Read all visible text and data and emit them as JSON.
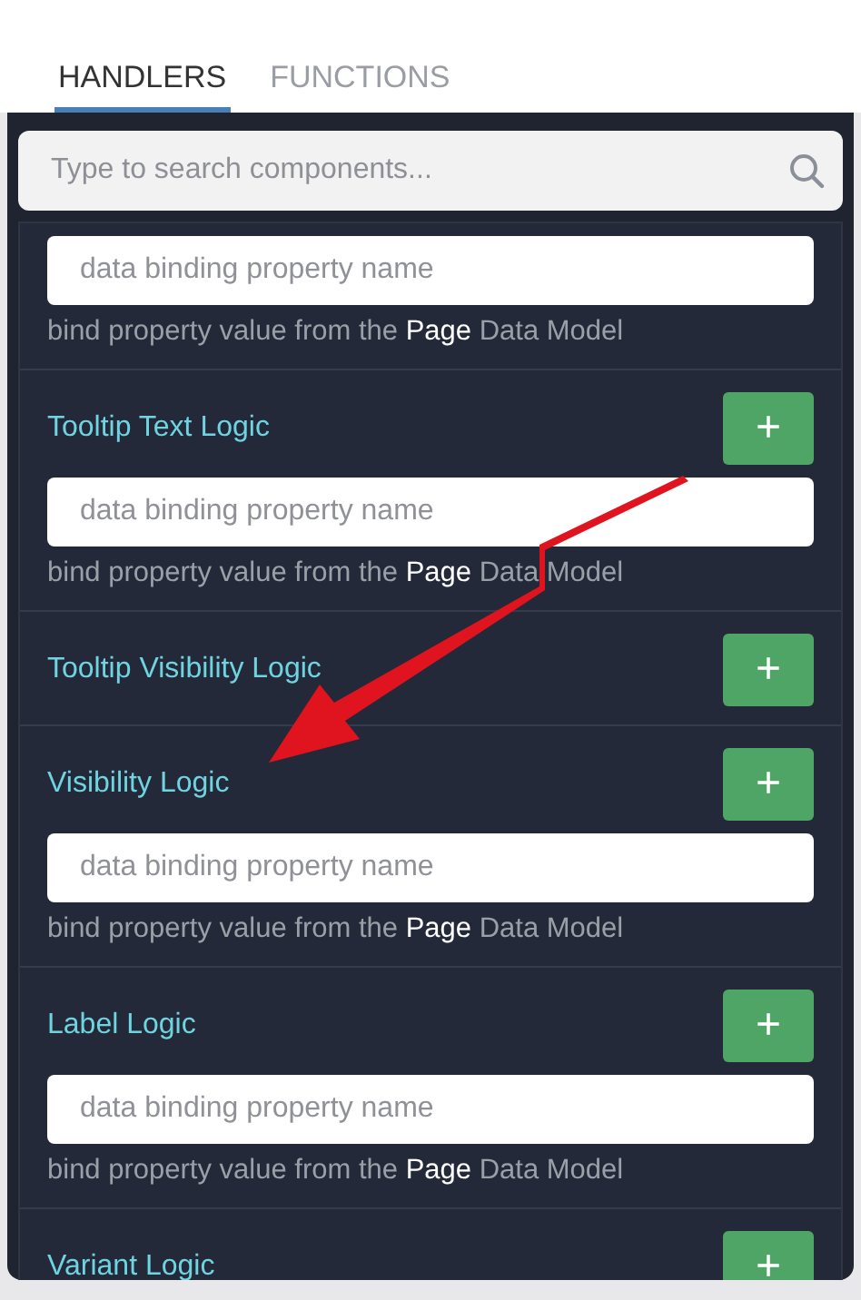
{
  "tabs": [
    {
      "label": "HANDLERS",
      "selected": true
    },
    {
      "label": "FUNCTIONS",
      "selected": false
    }
  ],
  "search": {
    "placeholder": "Type to search components..."
  },
  "sections": [
    {
      "kind": "binding",
      "field_placeholder": "data binding property name",
      "hint": "bind property value from the **Page** Data Model"
    },
    {
      "kind": "binding",
      "title": "Tooltip Text Logic",
      "button": "+",
      "field_placeholder": "data binding property name",
      "hint": "bind property value from the **Page** Data Model"
    },
    {
      "kind": "simple",
      "title": "Tooltip Visibility Logic",
      "button": "+"
    },
    {
      "kind": "binding",
      "title": "Visibility Logic",
      "button": "+",
      "field_placeholder": "data binding property name",
      "hint": "bind property value from the **Page** Data Model"
    },
    {
      "kind": "binding",
      "title": "Label Logic",
      "button": "+",
      "field_placeholder": "data binding property name",
      "hint": "bind property value from the **Page** Data Model"
    },
    {
      "kind": "simple",
      "title": "Variant Logic",
      "button": "+"
    }
  ],
  "annotation": {
    "kind": "arrow"
  }
}
